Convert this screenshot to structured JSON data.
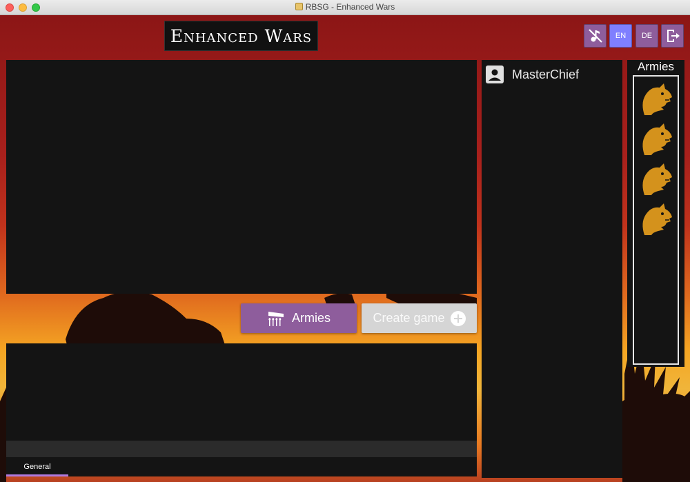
{
  "window": {
    "title": "RBSG - Enhanced Wars"
  },
  "header": {
    "logo": "Enhanced Wars",
    "buttons": {
      "music_icon": "music-off-icon",
      "en": "EN",
      "de": "DE",
      "logout_icon": "logout-icon"
    }
  },
  "actions": {
    "armies_label": "Armies",
    "armies_icon": "army-banner-icon",
    "create_game_label": "Create game",
    "create_game_icon": "plus-circle-icon"
  },
  "chat": {
    "input_placeholder": "",
    "tabs": [
      {
        "label": "General",
        "active": true
      }
    ]
  },
  "users": [
    {
      "name": "MasterChief",
      "icon": "account-box-icon"
    }
  ],
  "armies_sidebar": {
    "title": "Armies",
    "items": [
      {
        "icon": "dragon-icon"
      },
      {
        "icon": "dragon-icon"
      },
      {
        "icon": "dragon-icon"
      },
      {
        "icon": "dragon-icon"
      }
    ]
  },
  "colors": {
    "accent_purple": "#8e5d9c",
    "lang_active": "#7f7fff",
    "panel_bg": "#141414",
    "dragon_gold": "#d4921c",
    "tab_underline": "#b07ae0"
  }
}
